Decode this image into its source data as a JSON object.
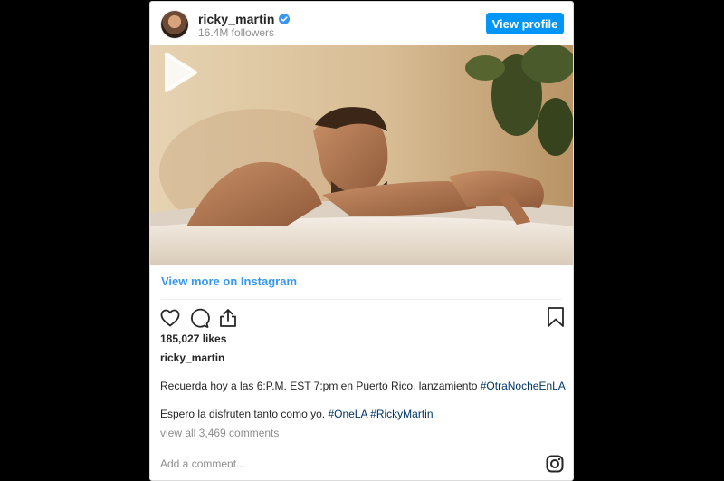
{
  "post": {
    "username": "ricky_martin",
    "followers": "16.4M followers",
    "view_profile_label": "View profile",
    "view_more_label": "View more on Instagram",
    "likes": "185,027 likes",
    "caption_user": "ricky_martin",
    "caption_line1_text": "Recuerda hoy a las 6:P.M. EST 7:pm en Puerto Rico. lanzamiento ",
    "caption_line1_tag": "#OtraNocheEnLA",
    "caption_line2_text": "Espero la disfruten tanto como yo. ",
    "caption_line2_tag1": "#OneLA",
    "caption_line2_tag2": "#RickyMartin",
    "view_comments_label": "view all 3,469 comments",
    "comment_placeholder": "Add a comment..."
  },
  "icons": {
    "verified": "verified-badge-icon",
    "play": "play-icon",
    "like": "heart-icon",
    "comment": "comment-icon",
    "share": "share-icon",
    "save": "bookmark-icon",
    "instagram": "instagram-logo-icon"
  },
  "colors": {
    "accent": "#0095f6",
    "link": "#3897f0",
    "hashtag": "#003569",
    "muted": "#8e8e8e",
    "text": "#262626",
    "background": "#000000"
  }
}
